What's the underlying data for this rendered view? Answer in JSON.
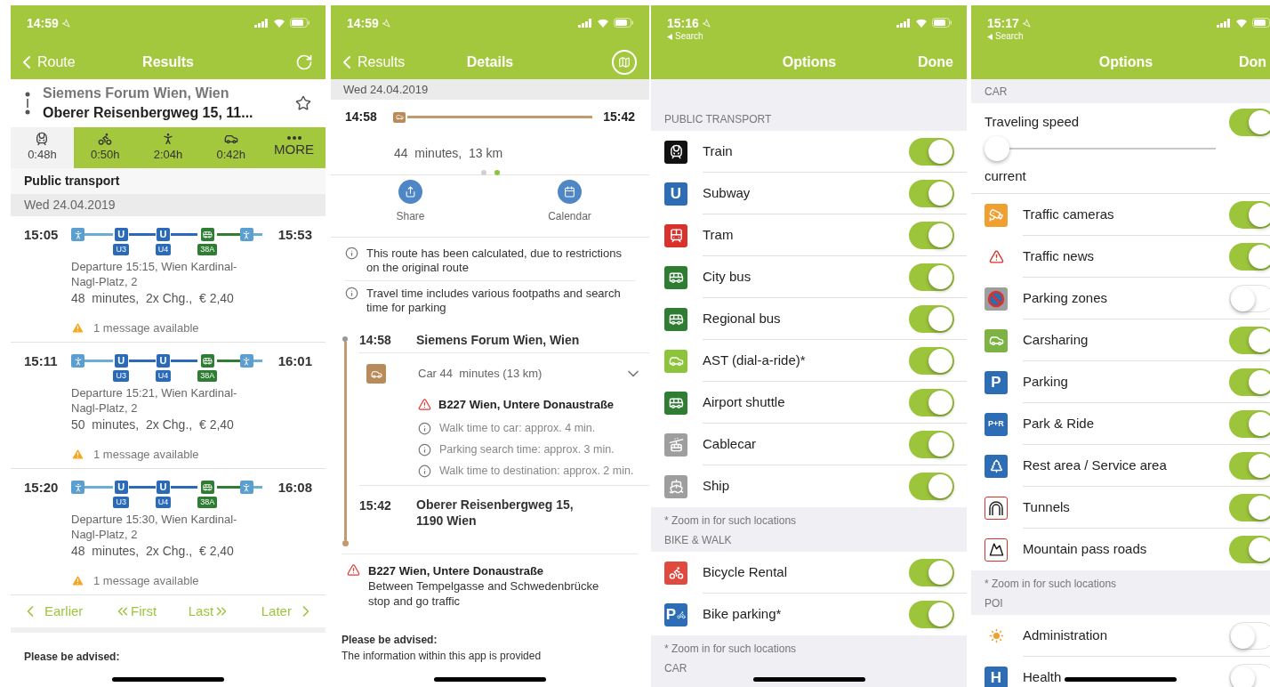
{
  "results_screen": {
    "status": {
      "time": "14:59"
    },
    "nav": {
      "back": "Route",
      "title": "Results"
    },
    "route": {
      "from": "Siemens Forum Wien, Wien",
      "to": "Oberer Reisenbergweg 15, 11..."
    },
    "modes": [
      {
        "kind": "transit",
        "label": "0:48h",
        "selected": true
      },
      {
        "kind": "bike",
        "label": "0:50h",
        "selected": false
      },
      {
        "kind": "walk",
        "label": "2:04h",
        "selected": false
      },
      {
        "kind": "car",
        "label": "0:42h",
        "selected": false
      },
      {
        "kind": "more",
        "label": "MORE",
        "selected": false
      }
    ],
    "section": "Public transport",
    "date": "Wed 24.04.2019",
    "connections": [
      {
        "depart": "15:05",
        "arrive": "15:53",
        "legs": [
          {
            "kind": "walk"
          },
          {
            "kind": "subway",
            "symbol": "U",
            "line": "U3"
          },
          {
            "kind": "subway",
            "symbol": "U",
            "line": "U4"
          },
          {
            "kind": "bus",
            "line": "38A"
          },
          {
            "kind": "walk"
          }
        ],
        "departure": "Departure 15:15, Wien Kardinal-Nagl-Platz, 2",
        "summary": "48  minutes,  2x Chg.,  € 2,40",
        "message": "1 message available"
      },
      {
        "depart": "15:11",
        "arrive": "16:01",
        "legs": [
          {
            "kind": "walk"
          },
          {
            "kind": "subway",
            "symbol": "U",
            "line": "U3"
          },
          {
            "kind": "subway",
            "symbol": "U",
            "line": "U4"
          },
          {
            "kind": "bus",
            "line": "38A"
          },
          {
            "kind": "walk"
          }
        ],
        "departure": "Departure 15:21, Wien Kardinal-Nagl-Platz, 2",
        "summary": "50  minutes,  2x Chg.,  € 2,40",
        "message": "1 message available"
      },
      {
        "depart": "15:20",
        "arrive": "16:08",
        "legs": [
          {
            "kind": "walk"
          },
          {
            "kind": "subway",
            "symbol": "U",
            "line": "U3"
          },
          {
            "kind": "subway",
            "symbol": "U",
            "line": "U4"
          },
          {
            "kind": "bus",
            "line": "38A"
          },
          {
            "kind": "walk"
          }
        ],
        "departure": "Departure 15:30, Wien Kardinal-Nagl-Platz, 2",
        "summary": "48  minutes,  2x Chg.,  € 2,40",
        "message": "1 message available"
      }
    ],
    "paging": {
      "earlier": "Earlier",
      "first": "First",
      "last": "Last",
      "later": "Later"
    },
    "advice": "Please be advised:"
  },
  "details_screen": {
    "status": {
      "time": "14:59"
    },
    "nav": {
      "back": "Results",
      "title": "Details"
    },
    "date": "Wed 24.04.2019",
    "summary": {
      "depart": "14:58",
      "arrive": "15:42",
      "info": "44  minutes,  13 km"
    },
    "pages": [
      {
        "selected": false
      },
      {
        "selected": true
      }
    ],
    "actions": [
      {
        "kind": "share",
        "label": "Share"
      },
      {
        "kind": "calendar",
        "label": "Calendar"
      }
    ],
    "notes": [
      "This route has been calculated, due to restrictions on the original route",
      "Travel time includes various footpaths and search time for parking"
    ],
    "itinerary": {
      "start": {
        "time": "14:58",
        "place": "Siemens Forum Wien, Wien"
      },
      "leg": {
        "label": "Car 44  minutes (13 km)",
        "warning": "B227 Wien, Untere Donaustraße",
        "infos": [
          "Walk time to car: approx. 4 min.",
          "Parking search time: approx. 3 min.",
          "Walk time to destination: approx. 2 min."
        ]
      },
      "end": {
        "time": "15:42",
        "place": "Oberer Reisenbergweg 15, 1190 Wien"
      }
    },
    "traffic": {
      "title": "B227 Wien, Untere Donaustraße",
      "lines": [
        "Between Tempelgasse and Schwedenbrücke",
        "stop and go traffic"
      ]
    },
    "advice": {
      "title": "Please be advised:",
      "text": "The information within this app is provided"
    }
  },
  "options_screens": [
    {
      "status": {
        "time": "15:16"
      },
      "back_app": "Search",
      "title": "Options",
      "done": "Done",
      "sections": [
        {
          "header": "PUBLIC TRANSPORT",
          "rows": [
            {
              "kind": "train",
              "label": "Train",
              "on": true
            },
            {
              "kind": "subway",
              "badge": "U",
              "label": "Subway",
              "on": true
            },
            {
              "kind": "tram",
              "label": "Tram",
              "on": true
            },
            {
              "kind": "bus",
              "label": "City bus",
              "on": true
            },
            {
              "kind": "bus",
              "label": "Regional bus",
              "on": true
            },
            {
              "kind": "ast",
              "label": "AST (dial-a-ride)*",
              "on": true
            },
            {
              "kind": "bus",
              "label": "Airport shuttle",
              "on": true
            },
            {
              "kind": "cablecar",
              "label": "Cablecar",
              "on": true
            },
            {
              "kind": "ship",
              "label": "Ship",
              "on": true
            }
          ],
          "footer": "* Zoom in for such locations"
        },
        {
          "header": "BIKE & WALK",
          "rows": [
            {
              "kind": "bicycle",
              "label": "Bicycle Rental",
              "on": true
            },
            {
              "kind": "bikeparking",
              "badge": "P",
              "label": "Bike parking*",
              "on": true
            }
          ],
          "footer": "* Zoom in for such locations"
        },
        {
          "header": "CAR"
        }
      ]
    },
    {
      "status": {
        "time": "15:17"
      },
      "back_app": "Search",
      "title": "Options",
      "done": "Don",
      "sections": [
        {
          "header": "CAR",
          "rows": [
            {
              "kind": "speed",
              "label": "Traveling speed",
              "on": true,
              "level": 0,
              "caption": "current"
            },
            {
              "kind": "camera",
              "label": "Traffic cameras",
              "on": true
            },
            {
              "kind": "warning",
              "label": "Traffic news",
              "on": true
            },
            {
              "kind": "noparking",
              "label": "Parking zones",
              "on": false
            },
            {
              "kind": "carsharing",
              "label": "Carsharing",
              "on": true
            },
            {
              "kind": "parking",
              "badge": "P",
              "label": "Parking",
              "on": true
            },
            {
              "kind": "parkride",
              "badge": "P+R",
              "label": "Park & Ride",
              "on": true
            },
            {
              "kind": "rest",
              "label": "Rest area / Service area",
              "on": true
            },
            {
              "kind": "tunnel",
              "label": "Tunnels",
              "on": true
            },
            {
              "kind": "mountain",
              "label": "Mountain pass roads",
              "on": true
            }
          ],
          "footer": "* Zoom in for such locations"
        },
        {
          "header": "POI",
          "rows": [
            {
              "kind": "sun",
              "label": "Administration",
              "on": false
            },
            {
              "kind": "health",
              "badge": "H",
              "label": "Health",
              "on": false
            }
          ]
        }
      ]
    }
  ]
}
